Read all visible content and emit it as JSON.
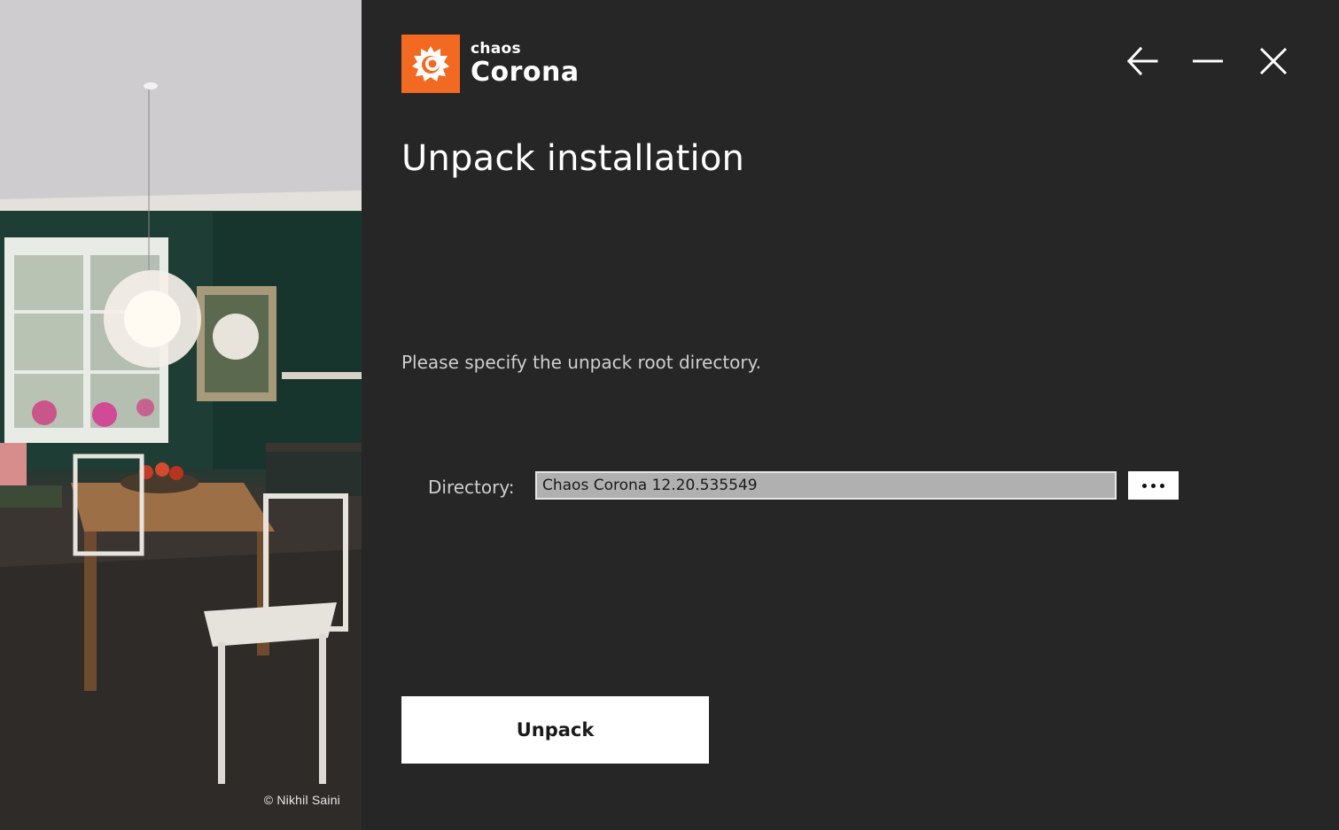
{
  "brand": {
    "company": "chaos",
    "product": "Corona",
    "accent_color": "#f26a21",
    "logo_icon": "corona-flame-icon"
  },
  "side_panel": {
    "credit": "© Nikhil Saini"
  },
  "window_controls": {
    "back_icon": "back-arrow-icon",
    "minimize_icon": "minimize-icon",
    "close_icon": "close-icon"
  },
  "page": {
    "title": "Unpack installation",
    "instruction": "Please specify the unpack root directory."
  },
  "directory": {
    "label": "Directory:",
    "value": "Chaos Corona 12.20.535549",
    "browse_icon": "ellipsis-icon"
  },
  "actions": {
    "unpack_label": "Unpack"
  }
}
